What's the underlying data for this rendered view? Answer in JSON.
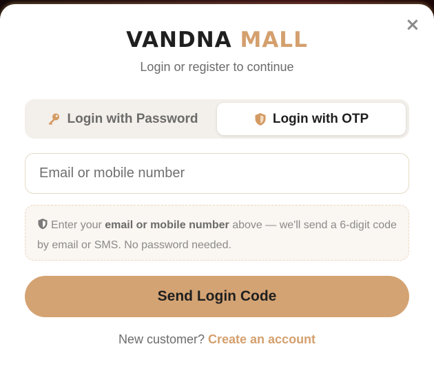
{
  "modal": {
    "close_glyph": "×",
    "brand_part1": "VANDNA",
    "brand_part2": "MALL",
    "subtitle": "Login or register to continue"
  },
  "tabs": [
    {
      "label": "Login with Password",
      "icon": "key-icon",
      "active": false
    },
    {
      "label": "Login with OTP",
      "icon": "shield-icon",
      "active": true
    }
  ],
  "form": {
    "identifier_placeholder": "Email or mobile number",
    "identifier_value": "",
    "info_prefix": "Enter your",
    "info_bold": "email or mobile number",
    "info_suffix": "above — we'll send a 6-digit code by email or SMS. No password needed.",
    "submit_label": "Send Login Code"
  },
  "footer": {
    "prompt": "New customer?",
    "link_label": "Create an account"
  },
  "colors": {
    "accent": "#d4a373",
    "brand_accent": "#d4a06e"
  }
}
